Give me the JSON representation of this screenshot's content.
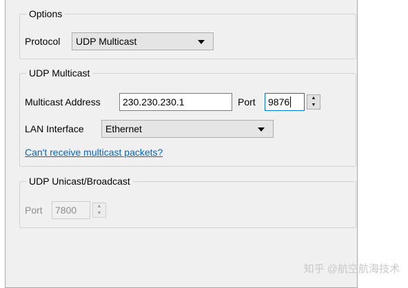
{
  "options": {
    "title": "Options",
    "protocol_label": "Protocol",
    "protocol_value": "UDP Multicast"
  },
  "multicast": {
    "title": "UDP Multicast",
    "address_label": "Multicast Address",
    "address_value": "230.230.230.1",
    "port_label": "Port",
    "port_value": "9876",
    "lan_label": "LAN Interface",
    "lan_value": "Ethernet",
    "help_link": "Can't receive multicast packets?"
  },
  "unicast": {
    "title": "UDP Unicast/Broadcast",
    "port_label": "Port",
    "port_value": "7800"
  },
  "watermark": "知乎 @航空航海技术"
}
